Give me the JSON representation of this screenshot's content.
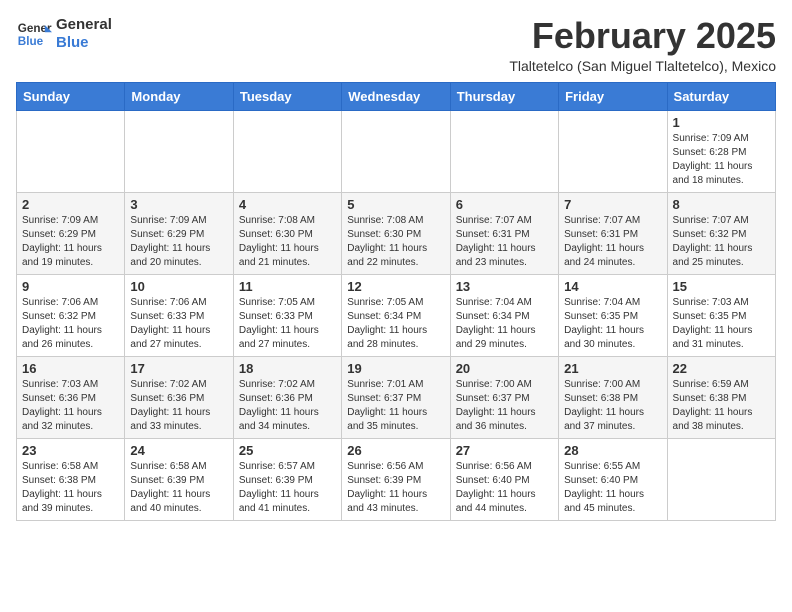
{
  "header": {
    "logo": {
      "line1": "General",
      "line2": "Blue"
    },
    "month_year": "February 2025",
    "location": "Tlaltetelco (San Miguel Tlaltetelco), Mexico"
  },
  "weekdays": [
    "Sunday",
    "Monday",
    "Tuesday",
    "Wednesday",
    "Thursday",
    "Friday",
    "Saturday"
  ],
  "weeks": [
    [
      {
        "day": "",
        "info": ""
      },
      {
        "day": "",
        "info": ""
      },
      {
        "day": "",
        "info": ""
      },
      {
        "day": "",
        "info": ""
      },
      {
        "day": "",
        "info": ""
      },
      {
        "day": "",
        "info": ""
      },
      {
        "day": "1",
        "info": "Sunrise: 7:09 AM\nSunset: 6:28 PM\nDaylight: 11 hours\nand 18 minutes."
      }
    ],
    [
      {
        "day": "2",
        "info": "Sunrise: 7:09 AM\nSunset: 6:29 PM\nDaylight: 11 hours\nand 19 minutes."
      },
      {
        "day": "3",
        "info": "Sunrise: 7:09 AM\nSunset: 6:29 PM\nDaylight: 11 hours\nand 20 minutes."
      },
      {
        "day": "4",
        "info": "Sunrise: 7:08 AM\nSunset: 6:30 PM\nDaylight: 11 hours\nand 21 minutes."
      },
      {
        "day": "5",
        "info": "Sunrise: 7:08 AM\nSunset: 6:30 PM\nDaylight: 11 hours\nand 22 minutes."
      },
      {
        "day": "6",
        "info": "Sunrise: 7:07 AM\nSunset: 6:31 PM\nDaylight: 11 hours\nand 23 minutes."
      },
      {
        "day": "7",
        "info": "Sunrise: 7:07 AM\nSunset: 6:31 PM\nDaylight: 11 hours\nand 24 minutes."
      },
      {
        "day": "8",
        "info": "Sunrise: 7:07 AM\nSunset: 6:32 PM\nDaylight: 11 hours\nand 25 minutes."
      }
    ],
    [
      {
        "day": "9",
        "info": "Sunrise: 7:06 AM\nSunset: 6:32 PM\nDaylight: 11 hours\nand 26 minutes."
      },
      {
        "day": "10",
        "info": "Sunrise: 7:06 AM\nSunset: 6:33 PM\nDaylight: 11 hours\nand 27 minutes."
      },
      {
        "day": "11",
        "info": "Sunrise: 7:05 AM\nSunset: 6:33 PM\nDaylight: 11 hours\nand 27 minutes."
      },
      {
        "day": "12",
        "info": "Sunrise: 7:05 AM\nSunset: 6:34 PM\nDaylight: 11 hours\nand 28 minutes."
      },
      {
        "day": "13",
        "info": "Sunrise: 7:04 AM\nSunset: 6:34 PM\nDaylight: 11 hours\nand 29 minutes."
      },
      {
        "day": "14",
        "info": "Sunrise: 7:04 AM\nSunset: 6:35 PM\nDaylight: 11 hours\nand 30 minutes."
      },
      {
        "day": "15",
        "info": "Sunrise: 7:03 AM\nSunset: 6:35 PM\nDaylight: 11 hours\nand 31 minutes."
      }
    ],
    [
      {
        "day": "16",
        "info": "Sunrise: 7:03 AM\nSunset: 6:36 PM\nDaylight: 11 hours\nand 32 minutes."
      },
      {
        "day": "17",
        "info": "Sunrise: 7:02 AM\nSunset: 6:36 PM\nDaylight: 11 hours\nand 33 minutes."
      },
      {
        "day": "18",
        "info": "Sunrise: 7:02 AM\nSunset: 6:36 PM\nDaylight: 11 hours\nand 34 minutes."
      },
      {
        "day": "19",
        "info": "Sunrise: 7:01 AM\nSunset: 6:37 PM\nDaylight: 11 hours\nand 35 minutes."
      },
      {
        "day": "20",
        "info": "Sunrise: 7:00 AM\nSunset: 6:37 PM\nDaylight: 11 hours\nand 36 minutes."
      },
      {
        "day": "21",
        "info": "Sunrise: 7:00 AM\nSunset: 6:38 PM\nDaylight: 11 hours\nand 37 minutes."
      },
      {
        "day": "22",
        "info": "Sunrise: 6:59 AM\nSunset: 6:38 PM\nDaylight: 11 hours\nand 38 minutes."
      }
    ],
    [
      {
        "day": "23",
        "info": "Sunrise: 6:58 AM\nSunset: 6:38 PM\nDaylight: 11 hours\nand 39 minutes."
      },
      {
        "day": "24",
        "info": "Sunrise: 6:58 AM\nSunset: 6:39 PM\nDaylight: 11 hours\nand 40 minutes."
      },
      {
        "day": "25",
        "info": "Sunrise: 6:57 AM\nSunset: 6:39 PM\nDaylight: 11 hours\nand 41 minutes."
      },
      {
        "day": "26",
        "info": "Sunrise: 6:56 AM\nSunset: 6:39 PM\nDaylight: 11 hours\nand 43 minutes."
      },
      {
        "day": "27",
        "info": "Sunrise: 6:56 AM\nSunset: 6:40 PM\nDaylight: 11 hours\nand 44 minutes."
      },
      {
        "day": "28",
        "info": "Sunrise: 6:55 AM\nSunset: 6:40 PM\nDaylight: 11 hours\nand 45 minutes."
      },
      {
        "day": "",
        "info": ""
      }
    ]
  ]
}
